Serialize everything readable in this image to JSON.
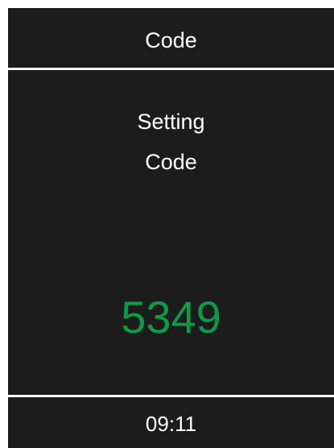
{
  "header": {
    "title": "Code"
  },
  "message": {
    "line1": "Setting",
    "line2": "Code"
  },
  "code": {
    "value": "5349",
    "color": "#0f9a48"
  },
  "footer": {
    "time": "09:11"
  },
  "colors": {
    "background": "#1c1c1c",
    "text": "#ffffff",
    "divider": "#ffffff"
  }
}
